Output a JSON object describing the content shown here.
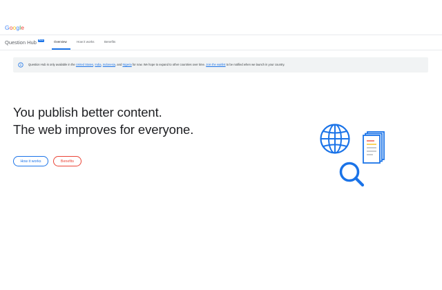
{
  "header": {
    "logo_text": "Google",
    "logo_letters": [
      {
        "char": "G",
        "color": "#4285f4"
      },
      {
        "char": "o",
        "color": "#ea4335"
      },
      {
        "char": "o",
        "color": "#fbbc05"
      },
      {
        "char": "g",
        "color": "#4285f4"
      },
      {
        "char": "l",
        "color": "#34a853"
      },
      {
        "char": "e",
        "color": "#ea4335"
      }
    ]
  },
  "nav": {
    "brand_name": "Question Hub",
    "beta_label": "Beta",
    "tabs": [
      {
        "label": "Overview",
        "active": true
      },
      {
        "label": "How it works",
        "active": false
      },
      {
        "label": "Benefits",
        "active": false
      }
    ]
  },
  "notice": {
    "icon": "info-icon",
    "text_prefix": "Question Hub is only available in the ",
    "link_us": "United States",
    "sep1": ", ",
    "link_india": "India",
    "sep2": ", ",
    "link_indonesia": "Indonesia",
    "text_and": ", and ",
    "link_nigeria": "Nigeria",
    "text_middle": " for now. We hope to expand to other countries over time. ",
    "link_waitlist": "Join the waitlist",
    "text_suffix": " to be notified when we launch in your country."
  },
  "hero": {
    "line1": "You publish better content.",
    "line2": "The web improves for everyone.",
    "button_how": "How it works",
    "button_benefits": "Benefits"
  },
  "colors": {
    "accent_blue": "#1a73e8",
    "accent_red": "#ea4335",
    "notice_bg": "#f1f3f4"
  },
  "illustration_icons": [
    "globe-icon",
    "document-stack-icon",
    "magnifier-icon"
  ]
}
